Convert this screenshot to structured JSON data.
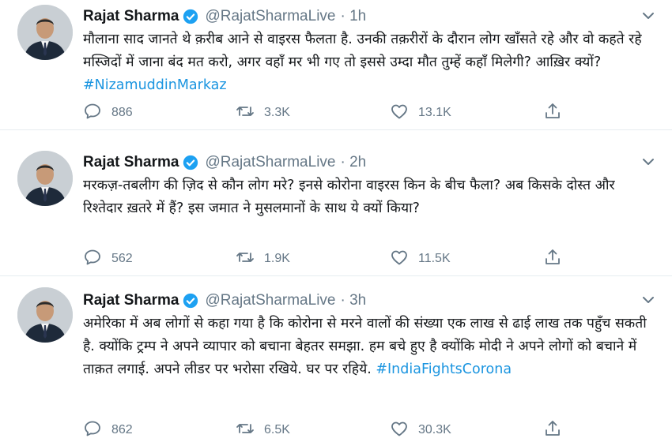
{
  "tweets": [
    {
      "name": "Rajat Sharma",
      "handle": "@RajatSharmaLive",
      "time": "· 1h",
      "text": "मौलाना साद जानते थे क़रीब आने से वाइरस फैलता है. उनकी तक़रीरों के दौरान लोग खाँसते रहे और वो कहते रहे मस्जिदों में जाना बंद मत करो, अगर वहाँ मर भी गए तो इससे उम्दा मौत तुम्हें कहाँ मिलेगी? आख़िर क्यों?",
      "hashtag": "#NizamuddinMarkaz",
      "replies": "886",
      "retweets": "3.3K",
      "likes": "13.1K"
    },
    {
      "name": "Rajat Sharma",
      "handle": "@RajatSharmaLive",
      "time": "· 2h",
      "text": "मरकज़-तबलीग की ज़िद से कौन लोग मरे? इनसे कोरोना वाइरस किन के बीच फैला? अब किसके दोस्त और रिश्तेदार ख़तरे में हैं? इस जमात ने मुसलमानों के साथ ये क्यों किया?",
      "hashtag": "",
      "replies": "562",
      "retweets": "1.9K",
      "likes": "11.5K"
    },
    {
      "name": "Rajat Sharma",
      "handle": "@RajatSharmaLive",
      "time": "· 3h",
      "text": "अमेरिका में अब लोगों से कहा गया है कि कोरोना से मरने वालों की संख्या एक लाख से ढाई लाख तक पहुँच सकती है. क्योंकि ट्रम्प ने अपने व्यापार को बचाना बेहतर समझा. हम बचे हुए है क्योंकि मोदी ने अपने लोगों को बचाने में ताक़त लगाई. अपने लीडर पर भरोसा रखिये. घर पर रहिये. ",
      "hashtag": "#IndiaFightsCorona",
      "replies": "862",
      "retweets": "6.5K",
      "likes": "30.3K"
    }
  ],
  "icons": {
    "verified": "verified-badge-icon",
    "caret": "chevron-down-icon",
    "reply": "reply-icon",
    "retweet": "retweet-icon",
    "like": "heart-icon",
    "share": "share-icon"
  },
  "colors": {
    "accent": "#1da1f2",
    "hashtag": "#1b95e0",
    "muted": "#657786",
    "text": "#14171a",
    "divider": "#e6ecf0"
  }
}
